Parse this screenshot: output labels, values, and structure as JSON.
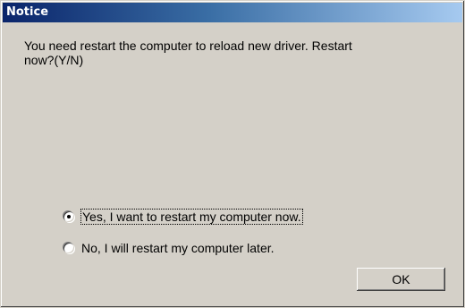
{
  "window": {
    "title": "Notice"
  },
  "message": "You need restart the computer to reload new driver. Restart\nnow?(Y/N)",
  "options": [
    {
      "label": "Yes, I want to restart my computer now.",
      "selected": true
    },
    {
      "label": "No, I will restart my computer later.",
      "selected": false
    }
  ],
  "buttons": {
    "ok_label": "OK"
  }
}
